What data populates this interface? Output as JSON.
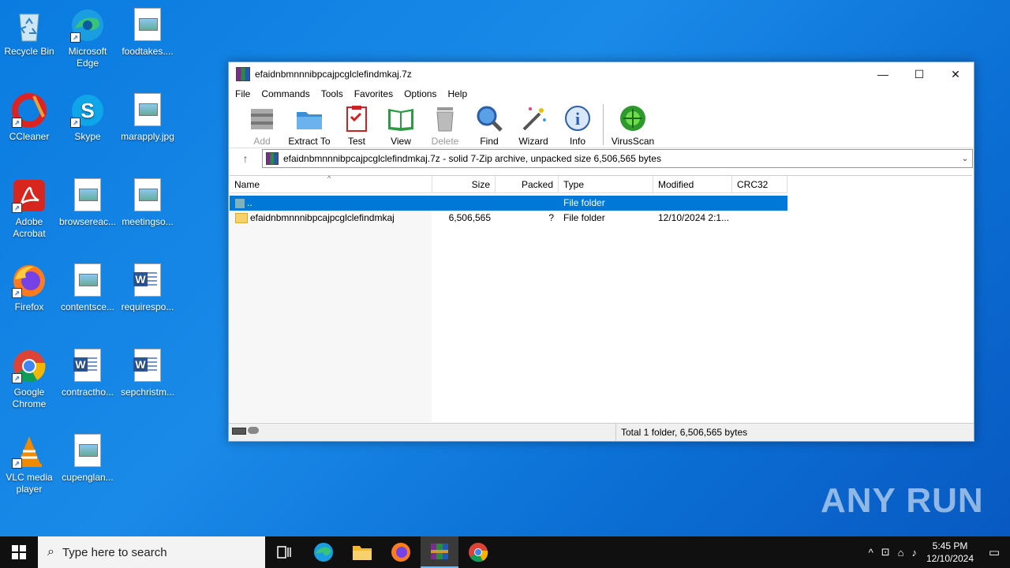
{
  "desktop": {
    "icons": [
      {
        "label": "Recycle Bin"
      },
      {
        "label": "Microsoft Edge"
      },
      {
        "label": "foodtakes...."
      },
      {
        "label": "CCleaner"
      },
      {
        "label": "Skype"
      },
      {
        "label": "marapply.jpg"
      },
      {
        "label": "Adobe Acrobat"
      },
      {
        "label": "browsereac..."
      },
      {
        "label": "meetingso..."
      },
      {
        "label": "Firefox"
      },
      {
        "label": "contentsce..."
      },
      {
        "label": "requirespo..."
      },
      {
        "label": "Google Chrome"
      },
      {
        "label": "contractho..."
      },
      {
        "label": "sepchristm..."
      },
      {
        "label": "VLC media player"
      },
      {
        "label": "cupenglan..."
      }
    ]
  },
  "window": {
    "title": "efaidnbmnnnibpcajpcglclefindmkaj.7z",
    "menu": [
      "File",
      "Commands",
      "Tools",
      "Favorites",
      "Options",
      "Help"
    ],
    "toolbar": {
      "add": "Add",
      "extract": "Extract To",
      "test": "Test",
      "view": "View",
      "delete": "Delete",
      "find": "Find",
      "wizard": "Wizard",
      "info": "Info",
      "virusscan": "VirusScan"
    },
    "address": "efaidnbmnnnibpcajpcglclefindmkaj.7z - solid 7-Zip archive, unpacked size 6,506,565 bytes",
    "columns": {
      "name": "Name",
      "size": "Size",
      "packed": "Packed",
      "type": "Type",
      "modified": "Modified",
      "crc": "CRC32"
    },
    "rows": [
      {
        "name": "..",
        "size": "",
        "packed": "",
        "type": "File folder",
        "modified": ""
      },
      {
        "name": "efaidnbmnnnibpcajpcglclefindmkaj",
        "size": "6,506,565",
        "packed": "?",
        "type": "File folder",
        "modified": "12/10/2024 2:1..."
      }
    ],
    "status": "Total 1 folder, 6,506,565 bytes"
  },
  "taskbar": {
    "search_placeholder": "Type here to search",
    "time": "5:45 PM",
    "date": "12/10/2024"
  },
  "watermark": "ANY RUN"
}
